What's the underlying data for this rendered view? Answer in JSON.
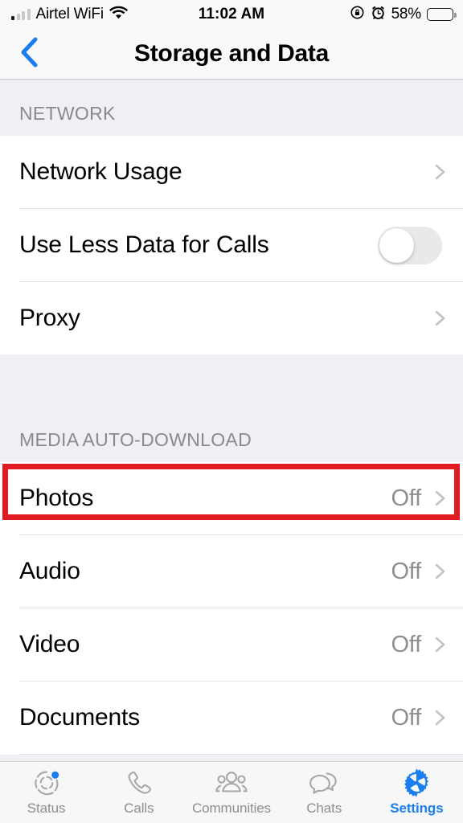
{
  "colors": {
    "accent": "#1a7ef0",
    "highlight": "#e11b22",
    "section_bg": "#efeff4",
    "row_bg": "#ffffff",
    "value_text": "#8e8e93",
    "header_text": "#8a8a8e"
  },
  "status_bar": {
    "carrier": "Airtel WiFi",
    "wifi_icon": "wifi-icon",
    "signal_icon": "signal-bars-icon",
    "time": "11:02 AM",
    "rotation_lock_icon": "rotation-lock-icon",
    "alarm_icon": "alarm-clock-icon",
    "battery_percent": "58%",
    "battery_level": 58,
    "battery_icon": "battery-icon"
  },
  "nav_bar": {
    "back_icon": "back-chevron-icon",
    "title": "Storage and Data"
  },
  "sections": [
    {
      "header": "NETWORK",
      "rows": [
        {
          "label": "Network Usage",
          "value": "",
          "accessory": "chevron"
        },
        {
          "label": "Use Less Data for Calls",
          "value": "",
          "accessory": "toggle",
          "toggle_on": false
        },
        {
          "label": "Proxy",
          "value": "",
          "accessory": "chevron"
        }
      ]
    },
    {
      "header": "MEDIA AUTO-DOWNLOAD",
      "rows": [
        {
          "label": "Photos",
          "value": "Off",
          "accessory": "chevron",
          "highlighted": true
        },
        {
          "label": "Audio",
          "value": "Off",
          "accessory": "chevron"
        },
        {
          "label": "Video",
          "value": "Off",
          "accessory": "chevron"
        },
        {
          "label": "Documents",
          "value": "Off",
          "accessory": "chevron"
        }
      ]
    }
  ],
  "tab_bar": {
    "tabs": [
      {
        "label": "Status",
        "icon": "status-ring-icon",
        "active": false,
        "badge": true
      },
      {
        "label": "Calls",
        "icon": "phone-icon",
        "active": false,
        "badge": false
      },
      {
        "label": "Communities",
        "icon": "communities-group-icon",
        "active": false,
        "badge": false
      },
      {
        "label": "Chats",
        "icon": "chat-bubbles-icon",
        "active": false,
        "badge": false
      },
      {
        "label": "Settings",
        "icon": "gear-icon",
        "active": true,
        "badge": false
      }
    ]
  }
}
